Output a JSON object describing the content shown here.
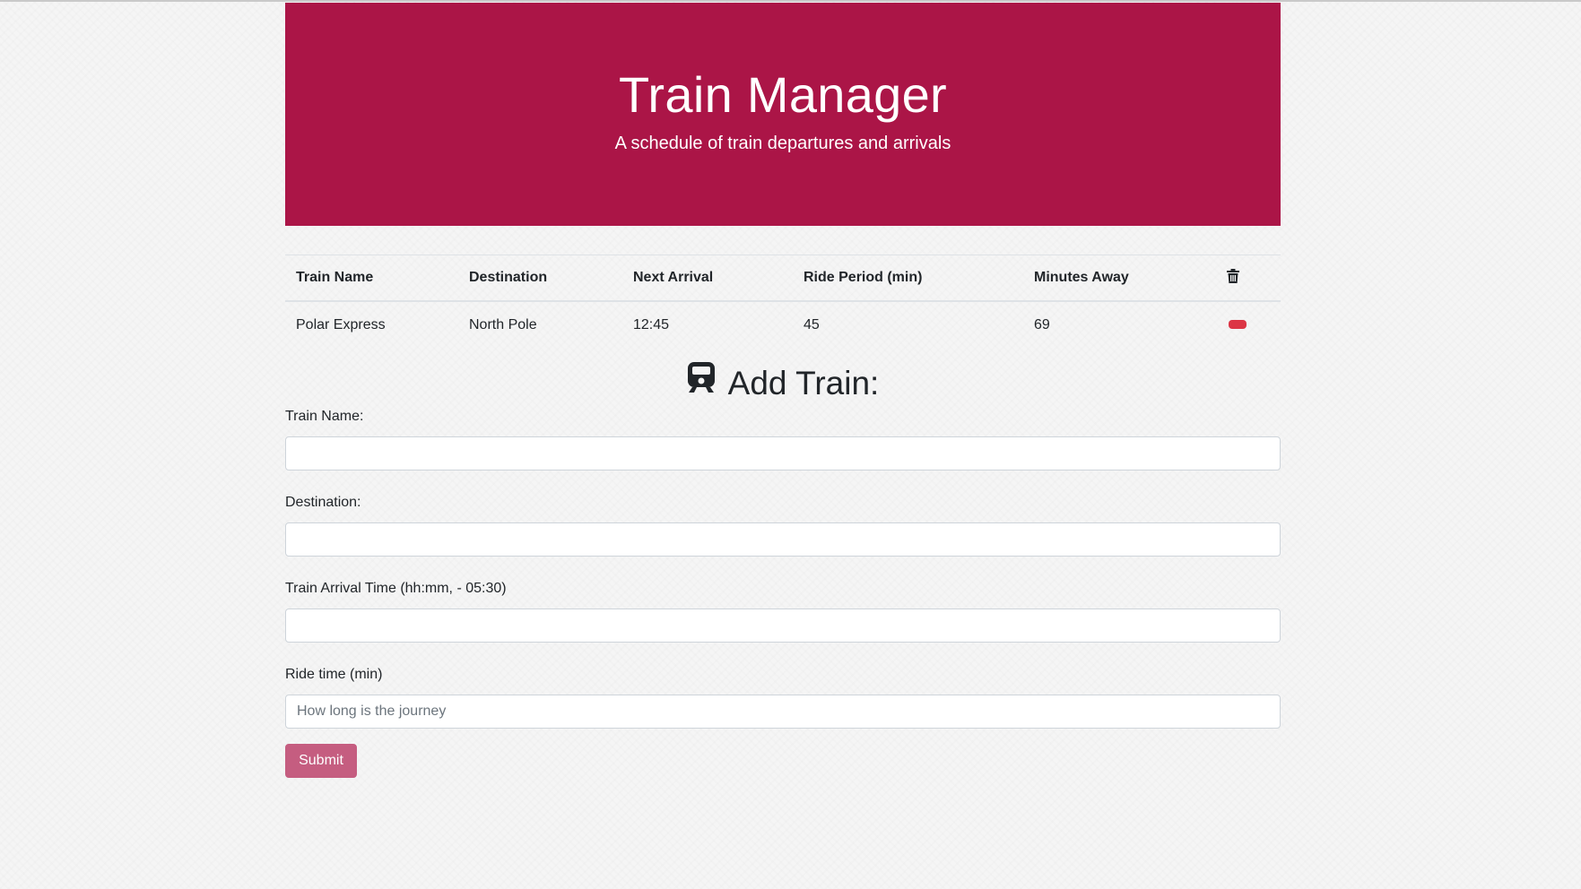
{
  "header": {
    "title": "Train Manager",
    "subtitle": "A schedule of train departures and arrivals"
  },
  "table": {
    "columns": [
      "Train Name",
      "Destination",
      "Next Arrival",
      "Ride Period (min)",
      "Minutes Away"
    ],
    "delete_column_icon": "trash-icon",
    "rows": [
      {
        "train_name": "Polar Express",
        "destination": "North Pole",
        "next_arrival": "12:45",
        "ride_period": "45",
        "minutes_away": "69"
      }
    ]
  },
  "form": {
    "title": "Add Train:",
    "title_icon": "train-icon",
    "fields": {
      "train_name": {
        "label": "Train Name:",
        "value": "",
        "placeholder": ""
      },
      "destination": {
        "label": "Destination:",
        "value": "",
        "placeholder": ""
      },
      "arrival_time": {
        "label": "Train Arrival Time (hh:mm, - 05:30)",
        "value": "",
        "placeholder": ""
      },
      "ride_time": {
        "label": "Ride time (min)",
        "value": "",
        "placeholder": "How long is the journey"
      }
    },
    "submit_label": "Submit"
  },
  "colors": {
    "brand": "#ab1547",
    "submit": "#c55d80",
    "delete": "#dc3545"
  }
}
